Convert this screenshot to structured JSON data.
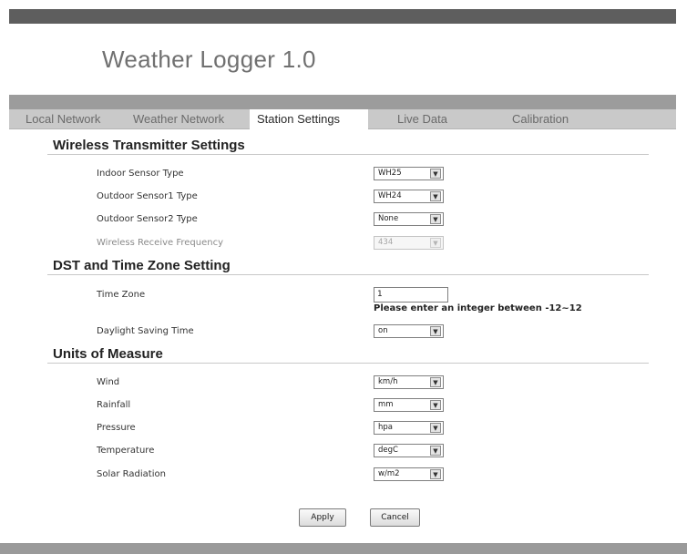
{
  "header": {
    "title": "Weather Logger 1.0"
  },
  "tabs": [
    {
      "label": "Local Network"
    },
    {
      "label": "Weather Network"
    },
    {
      "label": "Station Settings"
    },
    {
      "label": "Live Data"
    },
    {
      "label": "Calibration"
    }
  ],
  "wireless": {
    "heading": "Wireless Transmitter Settings",
    "indoor_sensor_type": {
      "label": "Indoor Sensor Type",
      "value": "WH25"
    },
    "outdoor_sensor1_type": {
      "label": "Outdoor Sensor1 Type",
      "value": "WH24"
    },
    "outdoor_sensor2_type": {
      "label": "Outdoor Sensor2 Type",
      "value": "None"
    },
    "receive_frequency": {
      "label": "Wireless Receive Frequency",
      "value": "434"
    }
  },
  "dst": {
    "heading": "DST and Time Zone Setting",
    "time_zone": {
      "label": "Time Zone",
      "value": "1",
      "hint": "Please enter an integer between -12~12"
    },
    "daylight_saving": {
      "label": "Daylight Saving Time",
      "value": "on"
    }
  },
  "units": {
    "heading": "Units of Measure",
    "wind": {
      "label": "Wind",
      "value": "km/h"
    },
    "rainfall": {
      "label": "Rainfall",
      "value": "mm"
    },
    "pressure": {
      "label": "Pressure",
      "value": "hpa"
    },
    "temperature": {
      "label": "Temperature",
      "value": "degC"
    },
    "solar_radiation": {
      "label": "Solar Radiation",
      "value": "w/m2"
    }
  },
  "buttons": {
    "apply": "Apply",
    "cancel": "Cancel"
  },
  "icons": {
    "select_arrow": "chevron-down-icon"
  }
}
